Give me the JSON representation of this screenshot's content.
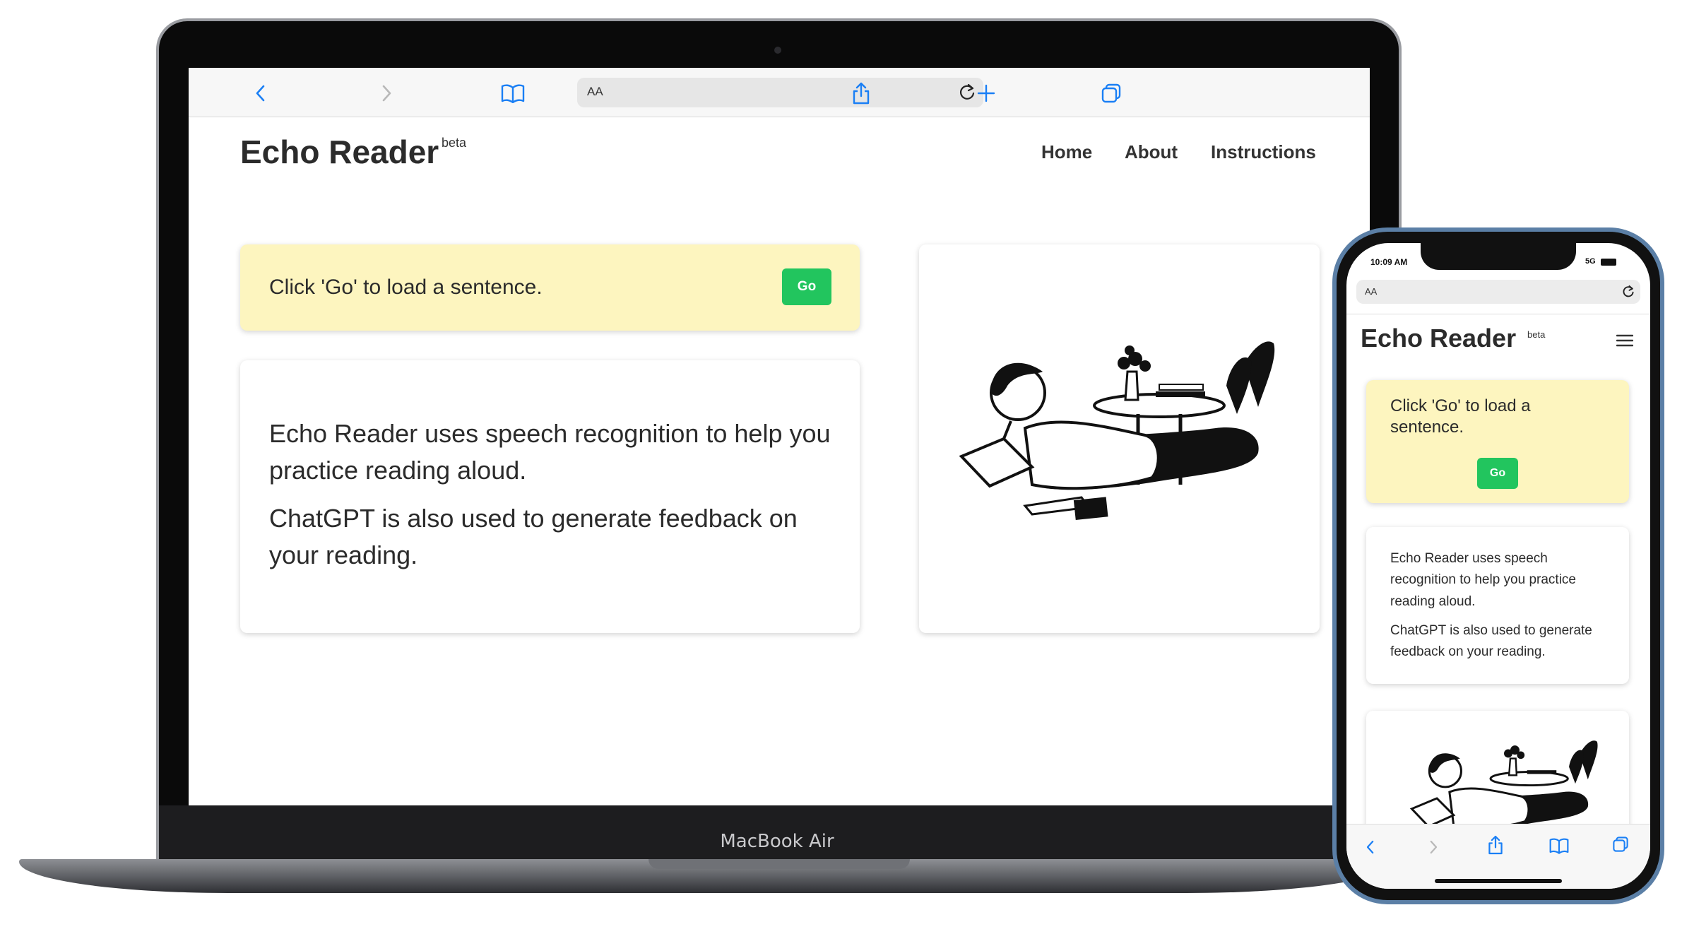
{
  "colors": {
    "accent_blue": "#1a7ff5",
    "go_green": "#22c55e",
    "prompt_yellow": "#fdf5bf",
    "text_dark": "#2b2b2b"
  },
  "desktop": {
    "device_label": "MacBook Air",
    "browser": {
      "address_aa": "AA",
      "icons": [
        "back-icon",
        "forward-icon",
        "bookmarks-icon",
        "reload-icon",
        "share-icon",
        "new-tab-icon",
        "tabs-icon"
      ]
    },
    "site": {
      "brand": "Echo Reader",
      "beta": "beta",
      "nav": [
        "Home",
        "About",
        "Instructions"
      ]
    },
    "prompt": {
      "text": "Click 'Go' to load a sentence.",
      "go_label": "Go"
    },
    "description": {
      "p1": "Echo Reader uses speech recognition to help you practice reading aloud.",
      "p2": "ChatGPT is also used to generate feedback on your reading."
    },
    "illustration": "woman-reading-illustration"
  },
  "mobile": {
    "time": "10:09 AM",
    "status": "5G",
    "browser": {
      "address_aa": "AA"
    },
    "site": {
      "brand": "Echo Reader",
      "beta": "beta"
    },
    "prompt": {
      "text": "Click 'Go' to load a sentence.",
      "go_label": "Go"
    },
    "description": {
      "p1": "Echo Reader uses speech recognition to help you practice reading aloud.",
      "p2": "ChatGPT is also used to generate feedback on your reading."
    },
    "illustration": "woman-reading-illustration"
  }
}
